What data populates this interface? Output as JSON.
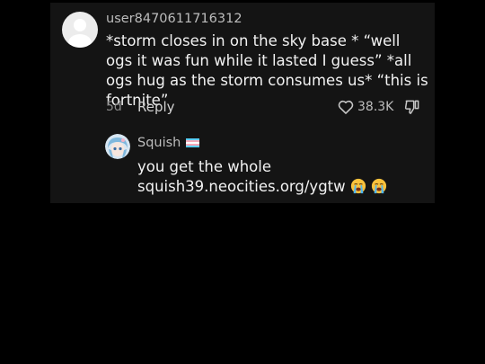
{
  "comment": {
    "username": "user8470611716312",
    "text": "*storm closes in on the sky base * “well ogs it was fun while it lasted I guess” *all ogs hug as the storm consumes us* “this is fortnite”",
    "age": "5d",
    "reply_label": "Reply",
    "like_count": "38.3K",
    "avatar_icon": "default-user-icon",
    "like_icon": "heart-outline-icon",
    "dislike_icon": "thumbs-down-icon"
  },
  "reply": {
    "username": "Squish",
    "flag_icon": "trans-flag-icon",
    "text": "you get the whole squish39.neocities.org/ygtw",
    "emojis": [
      "loudly-crying-face-icon",
      "loudly-crying-face-icon"
    ]
  },
  "colors": {
    "background": "#000000",
    "panel": "#141414",
    "text": "#f2f2f2",
    "muted": "#bdbdbd"
  }
}
